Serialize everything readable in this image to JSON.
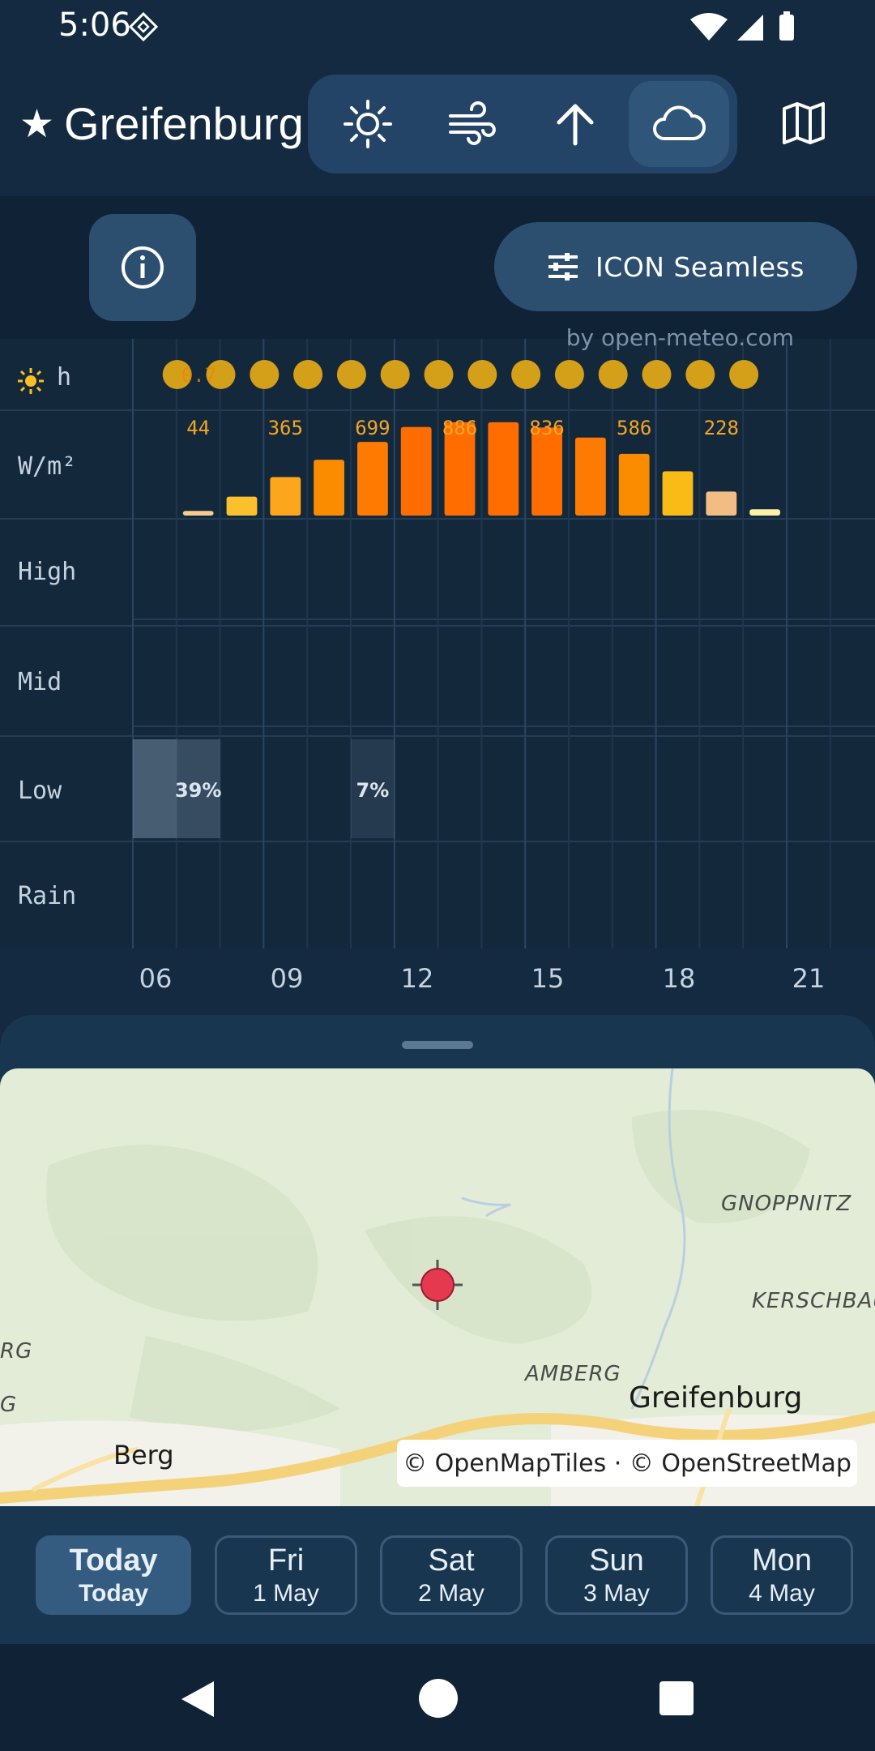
{
  "status": {
    "time": "5:06"
  },
  "header": {
    "location": "Greifenburg",
    "view_tabs": [
      "sun-icon",
      "wind-icon",
      "arrow-up-icon",
      "cloud-icon"
    ],
    "selected_tab": "cloud-icon"
  },
  "toolbar": {
    "model_label": "ICON Seamless"
  },
  "credit": "by open-meteo.com",
  "chart": {
    "row_labels": {
      "sun": "h",
      "radiation": "W/m²",
      "high": "High",
      "mid": "Mid",
      "low": "Low",
      "rain": "Rain"
    },
    "sunshine_first_label": "0.7",
    "radiation_labels": [
      "44",
      "365",
      "699",
      "886",
      "836",
      "586",
      "228"
    ],
    "low_cloud_labels": [
      "39%",
      "7%"
    ],
    "x_ticks": [
      "06",
      "09",
      "12",
      "15",
      "18",
      "21"
    ]
  },
  "chart_data": {
    "type": "bar",
    "categories": [
      "06",
      "07",
      "08",
      "09",
      "10",
      "11",
      "12",
      "13",
      "14",
      "15",
      "16",
      "17",
      "18",
      "19",
      "20",
      "21",
      "22"
    ],
    "series": [
      {
        "name": "W/m²",
        "values": [
          0,
          44,
          180,
          365,
          530,
          699,
          840,
          886,
          886,
          836,
          740,
          586,
          420,
          228,
          60,
          0,
          0
        ]
      },
      {
        "name": "Low",
        "values": [
          70,
          39,
          0,
          0,
          0,
          7,
          0,
          0,
          0,
          0,
          0,
          0,
          0,
          0,
          0,
          0,
          0
        ]
      }
    ],
    "colors": [
      "#fdf0a8",
      "#f5cd8e",
      "#fbc02d",
      "#fba61c",
      "#fb8c00",
      "#ff7a00",
      "#ff6d00",
      "#ff6d00",
      "#ff6d00",
      "#ff6d00",
      "#ff7a00",
      "#fb8c00",
      "#fbbb17",
      "#f1bd84",
      "#fdf0a8"
    ]
  },
  "map": {
    "labels": [
      "GNOPPNITZ",
      "KERSCHBAU",
      "AMBERG",
      "RG",
      "G"
    ],
    "cities": [
      "Greifenburg",
      "Berg"
    ],
    "attribution": "© OpenMapTiles · © OpenStreetMap"
  },
  "days": [
    {
      "day": "Today",
      "date": "Today",
      "selected": true
    },
    {
      "day": "Fri",
      "date": "1 May"
    },
    {
      "day": "Sat",
      "date": "2 May"
    },
    {
      "day": "Sun",
      "date": "3 May"
    },
    {
      "day": "Mon",
      "date": "4 May"
    }
  ]
}
